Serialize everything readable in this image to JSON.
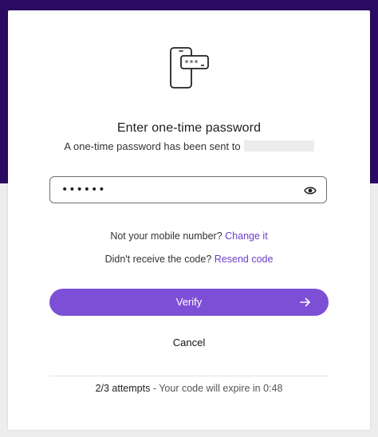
{
  "dialog": {
    "title": "Enter one-time password",
    "subtitle": "A one-time password has been sent to",
    "otp_value": "••••••",
    "mobile": {
      "prompt": "Not your mobile number?",
      "link": "Change it"
    },
    "resend": {
      "prompt": "Didn't receive the code?",
      "link": "Resend code"
    },
    "verify_label": "Verify",
    "cancel_label": "Cancel",
    "attempts": "2/3 attempts",
    "expiry_text": " - Your code will expire in 0:48"
  },
  "icons": {
    "hero": "phone-password-icon",
    "toggle_visibility": "eye-icon",
    "verify_arrow": "arrow-right-icon"
  },
  "colors": {
    "header_bg": "#2b0a62",
    "accent": "#7d4fd6",
    "link": "#6a3fc7"
  }
}
